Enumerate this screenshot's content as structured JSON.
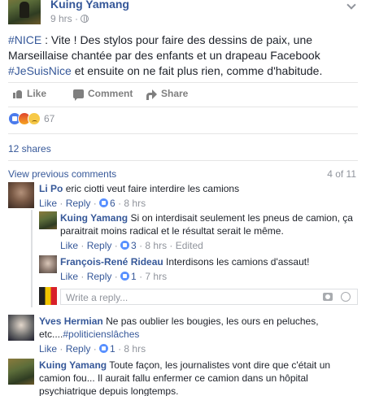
{
  "post": {
    "author": "Kuing Yamang",
    "time": "9 hrs",
    "text_hashtag1": "#NICE",
    "text_part1": " : Vite ! Des stylos pour faire des dessins de paix, une Marseillaise chantée par des enfants et un drapeau Facebook ",
    "text_hashtag2": "#JeSuisNice",
    "text_part2": " et ensuite on ne fait plus rien, comme d'habitude."
  },
  "actions": {
    "like": "Like",
    "comment": "Comment",
    "share": "Share"
  },
  "reactions": {
    "count": "67"
  },
  "shares": "12 shares",
  "comments_nav": {
    "view_previous": "View previous comments",
    "counter": "4 of 11"
  },
  "comments": [
    {
      "author": "Li Po",
      "text": "eric ciotti veut faire interdire les camions",
      "like": "Like",
      "reply": "Reply",
      "likes": "6",
      "time": "8 hrs",
      "replies": [
        {
          "author": "Kuing Yamang",
          "text": "Si on interdisait seulement les pneus de camion, ça paraitrait moins radical et le résultat serait le même.",
          "like": "Like",
          "reply": "Reply",
          "likes": "3",
          "time": "8 hrs",
          "edited": "Edited"
        },
        {
          "author": "François-René Rideau",
          "text": "Interdisons les camions d'assaut!",
          "like": "Like",
          "reply": "Reply",
          "likes": "1",
          "time": "7 hrs"
        }
      ],
      "write_reply_placeholder": "Write a reply..."
    },
    {
      "author": "Yves Hermian",
      "text_part1": "Ne pas oublier les bougies, les ours en peluches, etc....",
      "hashtag": "#politicienslâches",
      "like": "Like",
      "reply": "Reply",
      "likes": "1",
      "time": "8 hrs"
    },
    {
      "author": "Kuing Yamang",
      "text": "Toute façon, les journalistes vont dire que c'était un camion fou... Il aurait fallu enfermer ce camion dans un hôpital psychiatrique depuis longtemps."
    }
  ]
}
